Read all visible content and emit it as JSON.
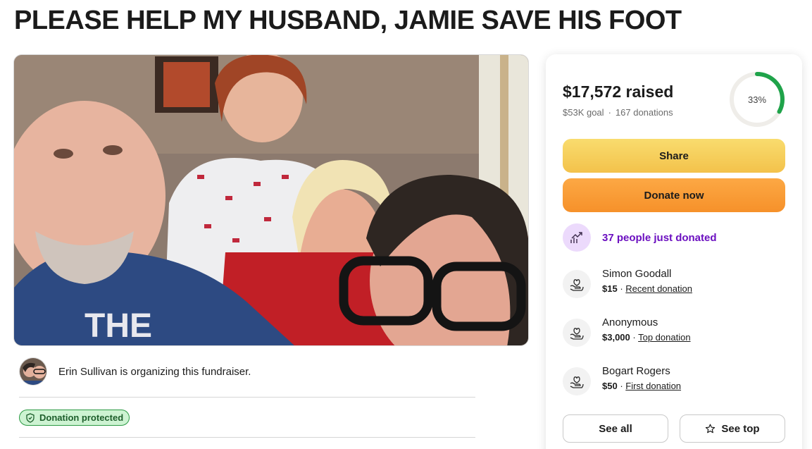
{
  "page": {
    "title": "PLEASE HELP MY HUSBAND, JAMIE SAVE HIS FOOT"
  },
  "organizer": {
    "text": "Erin Sullivan is organizing this fundraiser."
  },
  "protection": {
    "badge_label": "Donation protected"
  },
  "donation_card": {
    "raised": "$17,572 raised",
    "goal": "$53K goal",
    "separator": "·",
    "donations": "167 donations",
    "progress_percent": 33,
    "progress_label": "33%",
    "share_label": "Share",
    "donate_label": "Donate now",
    "trend_text": "37 people just donated",
    "donors": [
      {
        "name": "Simon Goodall",
        "amount": "$15",
        "sep": " · ",
        "tag": "Recent donation"
      },
      {
        "name": "Anonymous",
        "amount": "$3,000",
        "sep": " · ",
        "tag": "Top donation"
      },
      {
        "name": "Bogart Rogers",
        "amount": "$50",
        "sep": " · ",
        "tag": "First donation"
      }
    ],
    "see_all_label": "See all",
    "see_top_label": "See top"
  },
  "colors": {
    "share_button": "#f3c24b",
    "donate_button": "#f6912a",
    "progress_green": "#1fa34a",
    "trend_purple": "#6b0fc0",
    "protected_green": "#cdf3d2"
  },
  "icons": {
    "progress": "progress-ring",
    "trend": "trending-up-icon",
    "donor": "heart-hand-icon",
    "protected": "shield-icon",
    "see_top": "star-icon"
  }
}
